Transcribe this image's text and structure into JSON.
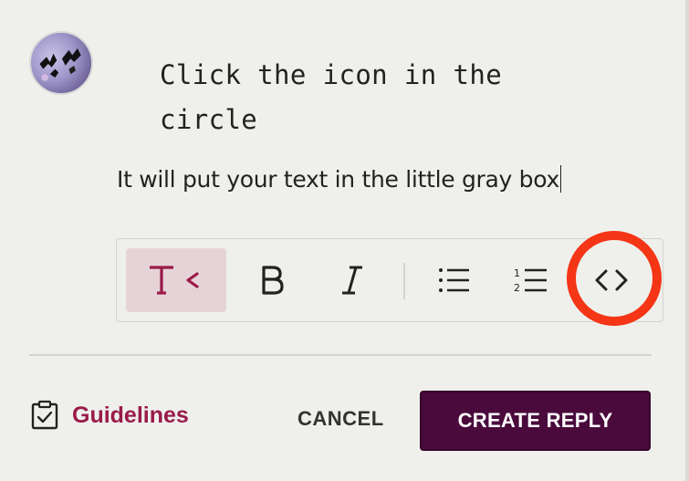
{
  "composer": {
    "code_text": "Click the icon in the circle",
    "plain_text": "It will put your text in the little gray box"
  },
  "toolbar": {
    "buttons": [
      {
        "name": "text-style",
        "icon": "text-style-icon",
        "active": true
      },
      {
        "name": "bold",
        "icon": "bold-icon",
        "active": false
      },
      {
        "name": "italic",
        "icon": "italic-icon",
        "active": false
      },
      {
        "name": "bullet-list",
        "icon": "bullet-list-icon",
        "active": false
      },
      {
        "name": "numbered-list",
        "icon": "numbered-list-icon",
        "active": false
      },
      {
        "name": "code",
        "icon": "code-icon",
        "active": false
      }
    ],
    "active_bg": "#e6d3d8",
    "accent": "#9a1b4a"
  },
  "annotation": {
    "highlight_color": "#f43516"
  },
  "footer": {
    "guidelines_label": "Guidelines",
    "cancel_label": "CANCEL",
    "create_label": "CREATE REPLY",
    "create_bg": "#4a0a3c"
  }
}
